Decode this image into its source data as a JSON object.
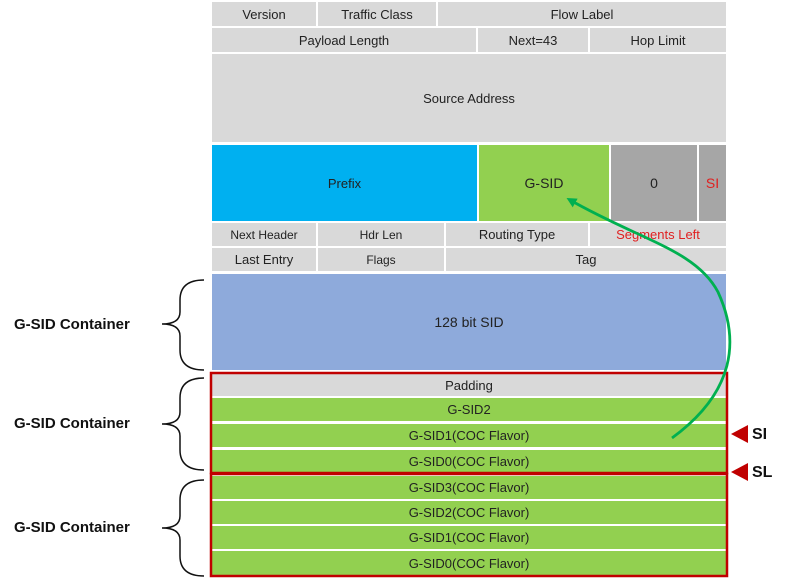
{
  "header": {
    "version": "Version",
    "traffic_class": "Traffic Class",
    "flow_label": "Flow Label",
    "payload_length": "Payload Length",
    "next_header": "Next=43",
    "hop_limit": "Hop Limit",
    "source_address": "Source Address"
  },
  "destination": {
    "prefix": "Prefix",
    "gsid": "G-SID",
    "zero": "0",
    "si": "SI"
  },
  "srh": {
    "next_header": "Next Header",
    "hdr_len": "Hdr Len",
    "routing_type": "Routing Type",
    "segments_left": "Segments Left",
    "last_entry": "Last Entry",
    "flags": "Flags",
    "tag": "Tag"
  },
  "containers": {
    "label": "G-SID Container",
    "sid128": "128 bit SID",
    "padding": "Padding",
    "c2": [
      "G-SID2",
      "G-SID1(COC Flavor)",
      "G-SID0(COC Flavor)"
    ],
    "c3": [
      "G-SID3(COC Flavor)",
      "G-SID2(COC Flavor)",
      "G-SID1(COC Flavor)",
      "G-SID0(COC Flavor)"
    ]
  },
  "markers": {
    "si": "SI",
    "sl": "SL"
  },
  "colors": {
    "gray": "#d9d9d9",
    "blue": "#00b0f0",
    "green": "#92d050",
    "steel_blue": "#8eaadb",
    "red_frame": "#c00000",
    "arrow": "#00b050",
    "highlight_text": "#e02020"
  }
}
